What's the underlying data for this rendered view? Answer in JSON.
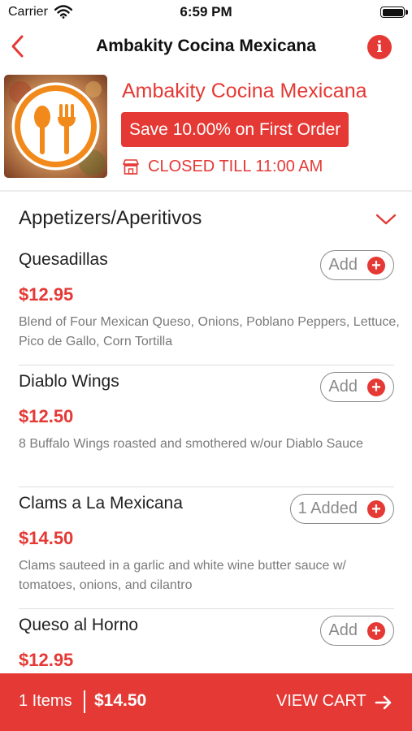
{
  "status_bar": {
    "carrier": "Carrier",
    "time": "6:59 PM",
    "icons": [
      "wifi-icon",
      "battery-icon"
    ]
  },
  "nav": {
    "title": "Ambakity Cocina Mexicana",
    "back_icon": "chevron-left-icon",
    "info_icon": "info-icon",
    "info_glyph": "i"
  },
  "restaurant": {
    "name": "Ambakity Cocina Mexicana",
    "promo": "Save 10.00% on First Order",
    "status": "CLOSED TILL 11:00 AM",
    "status_icon": "storefront-icon",
    "logo_icon": "spoon-fork-icon"
  },
  "category": {
    "title": "Appetizers/Aperitivos",
    "chevron_icon": "chevron-down-icon"
  },
  "items": [
    {
      "name": "Quesadillas",
      "price": "$12.95",
      "description": "Blend of Four Mexican Queso, Onions, Poblano Peppers, Lettuce, Pico de Gallo, Corn Tortilla",
      "button_label": "Add",
      "plus": "+"
    },
    {
      "name": "Diablo Wings",
      "price": "$12.50",
      "description": "8 Buffalo Wings roasted and smothered w/our Diablo Sauce",
      "button_label": "Add",
      "plus": "+"
    },
    {
      "name": "Clams a La Mexicana",
      "price": "$14.50",
      "description": "Clams sauteed in a garlic and white wine butter sauce w/ tomatoes, onions, and cilantro",
      "button_label": "1 Added",
      "plus": "+"
    },
    {
      "name": "Queso al Horno",
      "price": "$12.95",
      "description": "",
      "button_label": "Add",
      "plus": "+"
    }
  ],
  "cart": {
    "count": "1 Items",
    "total": "$14.50",
    "action": "VIEW CART",
    "arrow_icon": "arrow-right-icon"
  },
  "colors": {
    "accent": "#e53935",
    "logo_orange": "#f28a1b",
    "text_muted": "#7a7a7a"
  }
}
